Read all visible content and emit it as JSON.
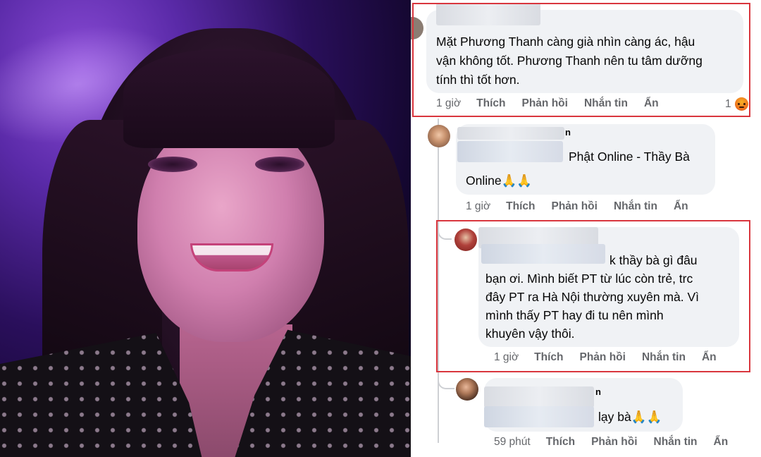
{
  "comments": [
    {
      "text_lines": [
        "Mặt Phương Thanh càng già nhìn càng ác, hậu",
        "vận không tốt. Phương Thanh nên tu tâm dưỡng",
        "tính thì tốt hơn."
      ],
      "time": "1 giờ",
      "like": "Thích",
      "reply": "Phản hồi",
      "message": "Nhắn tin",
      "hide": "Ẩn",
      "reaction_count": "1",
      "reaction_icon": "angry-reaction-icon",
      "highlighted": true
    },
    {
      "name_fragment": "n",
      "text_lines": [
        "Phật Online - Thầy Bà",
        "Online🙏🙏"
      ],
      "time": "1 giờ",
      "like": "Thích",
      "reply": "Phản hồi",
      "message": "Nhắn tin",
      "hide": "Ẩn"
    },
    {
      "text_lines": [
        "k thầy bà gì đâu",
        "bạn ơi. Mình biết PT từ lúc còn trẻ, trc",
        "đây PT ra Hà Nội thường xuyên mà. Vì",
        "mình thấy PT hay đi tu nên mình",
        "khuyên vậy thôi."
      ],
      "time": "1 giờ",
      "like": "Thích",
      "reply": "Phản hồi",
      "message": "Nhắn tin",
      "hide": "Ẩn",
      "highlighted": true
    },
    {
      "name_fragment": "n",
      "text_lines": [
        "lạy bà🙏🙏"
      ],
      "time": "59 phút",
      "like": "Thích",
      "reply": "Phản hồi",
      "message": "Nhắn tin",
      "hide": "Ẩn"
    }
  ],
  "colors": {
    "bubble": "#f0f2f5",
    "action_text": "#65676b",
    "highlight_border": "#d9363e",
    "text": "#050505"
  }
}
